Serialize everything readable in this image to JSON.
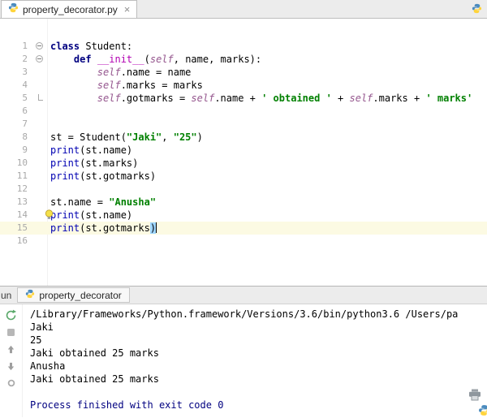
{
  "editor_tabbar": {
    "tab": {
      "label": "property_decorator.py"
    },
    "close_glyph": "×"
  },
  "editor": {
    "lines": [
      {
        "n": 1,
        "fold": "start",
        "tokens": [
          {
            "t": "class",
            "c": "kw"
          },
          {
            "t": " Student:",
            "c": "pl"
          }
        ]
      },
      {
        "n": 2,
        "fold": "start",
        "tokens": [
          {
            "t": "    ",
            "c": "pl"
          },
          {
            "t": "def ",
            "c": "kw"
          },
          {
            "t": "__init__",
            "c": "magic"
          },
          {
            "t": "(",
            "c": "pl"
          },
          {
            "t": "self",
            "c": "selfc"
          },
          {
            "t": ", name, marks):",
            "c": "pl"
          }
        ]
      },
      {
        "n": 3,
        "tokens": [
          {
            "t": "        ",
            "c": "pl"
          },
          {
            "t": "self",
            "c": "selfc"
          },
          {
            "t": ".name = name",
            "c": "pl"
          }
        ]
      },
      {
        "n": 4,
        "tokens": [
          {
            "t": "        ",
            "c": "pl"
          },
          {
            "t": "self",
            "c": "selfc"
          },
          {
            "t": ".marks = marks",
            "c": "pl"
          }
        ]
      },
      {
        "n": 5,
        "fold": "end",
        "tokens": [
          {
            "t": "        ",
            "c": "pl"
          },
          {
            "t": "self",
            "c": "selfc"
          },
          {
            "t": ".gotmarks = ",
            "c": "pl"
          },
          {
            "t": "self",
            "c": "selfc"
          },
          {
            "t": ".name + ",
            "c": "pl"
          },
          {
            "t": "' obtained '",
            "c": "str"
          },
          {
            "t": " + ",
            "c": "pl"
          },
          {
            "t": "self",
            "c": "selfc"
          },
          {
            "t": ".marks + ",
            "c": "pl"
          },
          {
            "t": "' marks'",
            "c": "str"
          }
        ]
      },
      {
        "n": 6,
        "tokens": []
      },
      {
        "n": 7,
        "tokens": []
      },
      {
        "n": 8,
        "tokens": [
          {
            "t": "st = Student(",
            "c": "pl"
          },
          {
            "t": "\"Jaki\"",
            "c": "str"
          },
          {
            "t": ", ",
            "c": "pl"
          },
          {
            "t": "\"25\"",
            "c": "str"
          },
          {
            "t": ")",
            "c": "pl"
          }
        ]
      },
      {
        "n": 9,
        "tokens": [
          {
            "t": "print",
            "c": "builtin"
          },
          {
            "t": "(st.name)",
            "c": "pl"
          }
        ]
      },
      {
        "n": 10,
        "tokens": [
          {
            "t": "print",
            "c": "builtin"
          },
          {
            "t": "(st.marks)",
            "c": "pl"
          }
        ]
      },
      {
        "n": 11,
        "tokens": [
          {
            "t": "print",
            "c": "builtin"
          },
          {
            "t": "(st.gotmarks)",
            "c": "pl"
          }
        ]
      },
      {
        "n": 12,
        "tokens": []
      },
      {
        "n": 13,
        "tokens": [
          {
            "t": "st.name = ",
            "c": "pl"
          },
          {
            "t": "\"Anusha\"",
            "c": "str"
          }
        ]
      },
      {
        "n": 14,
        "bulb": true,
        "tokens": [
          {
            "t": "print",
            "c": "builtin"
          },
          {
            "t": "(st.name)",
            "c": "pl"
          }
        ]
      },
      {
        "n": 15,
        "current": true,
        "caret": true,
        "tokens": [
          {
            "t": "print",
            "c": "builtin"
          },
          {
            "t": "(st.gotmarks",
            "c": "pl"
          },
          {
            "t": ")",
            "c": "match"
          }
        ]
      },
      {
        "n": 16,
        "tokens": []
      }
    ]
  },
  "run": {
    "toolwindow_label": "un",
    "tab": {
      "label": "property_decorator"
    },
    "toolbar_icons": [
      "rerun",
      "stop",
      "step-up",
      "step-down",
      "settings"
    ],
    "console": {
      "lines": [
        {
          "text": "/Library/Frameworks/Python.framework/Versions/3.6/bin/python3.6 /Users/pa",
          "style": "stdout"
        },
        {
          "text": "Jaki",
          "style": "stdout"
        },
        {
          "text": "25",
          "style": "stdout"
        },
        {
          "text": "Jaki obtained 25 marks",
          "style": "stdout"
        },
        {
          "text": "Anusha",
          "style": "stdout"
        },
        {
          "text": "Jaki obtained 25 marks",
          "style": "stdout"
        },
        {
          "text": "",
          "style": "stdout"
        },
        {
          "text": "Process finished with exit code 0",
          "style": "system"
        }
      ]
    }
  },
  "colors": {
    "keyword": "#000080",
    "string": "#008000",
    "selfc": "#94558D",
    "builtin": "#0000B2",
    "magic": "#B200B2",
    "current_line_bg": "#FCFAE3",
    "brace_match_bg": "#9FD6FF",
    "system_text": "#000080",
    "line_number": "#A9A9A9"
  }
}
